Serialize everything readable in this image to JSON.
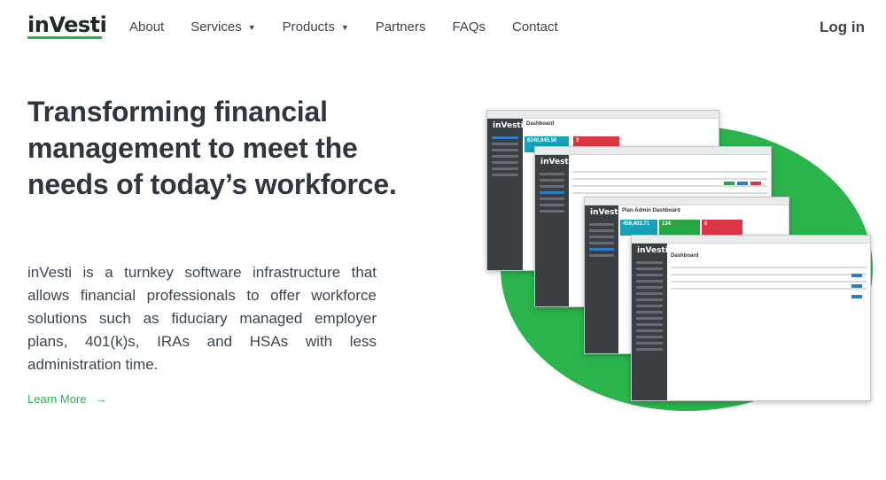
{
  "nav": {
    "logo": "inVesti",
    "items": [
      {
        "label": "About",
        "dropdown": false
      },
      {
        "label": "Services",
        "dropdown": true
      },
      {
        "label": "Products",
        "dropdown": true
      },
      {
        "label": "Partners",
        "dropdown": false
      },
      {
        "label": "FAQs",
        "dropdown": false
      },
      {
        "label": "Contact",
        "dropdown": false
      }
    ],
    "login": "Log in"
  },
  "hero": {
    "title": "Transforming financial management to meet the needs of today’s workforce.",
    "body": "inVesti is a turnkey software infrastructure that allows financial professionals to offer workforce solutions such as fiduciary managed employer plans, 401(k)s, IRAs and HSAs with less administration time.",
    "cta": "Learn More",
    "cta_arrow": "→"
  },
  "screens": {
    "s1_title": "Dashboard",
    "s1_card1": "$240,945.50",
    "s1_card2": "2",
    "s3_title": "Plan Admin Dashboard",
    "s3_card1": "459,403.71",
    "s3_card2": "134",
    "s3_card3": "6",
    "s4_title": "Dashboard"
  },
  "colors": {
    "accent": "#2cb34a",
    "text": "#2f3640",
    "sidebar": "#3a3f44"
  }
}
